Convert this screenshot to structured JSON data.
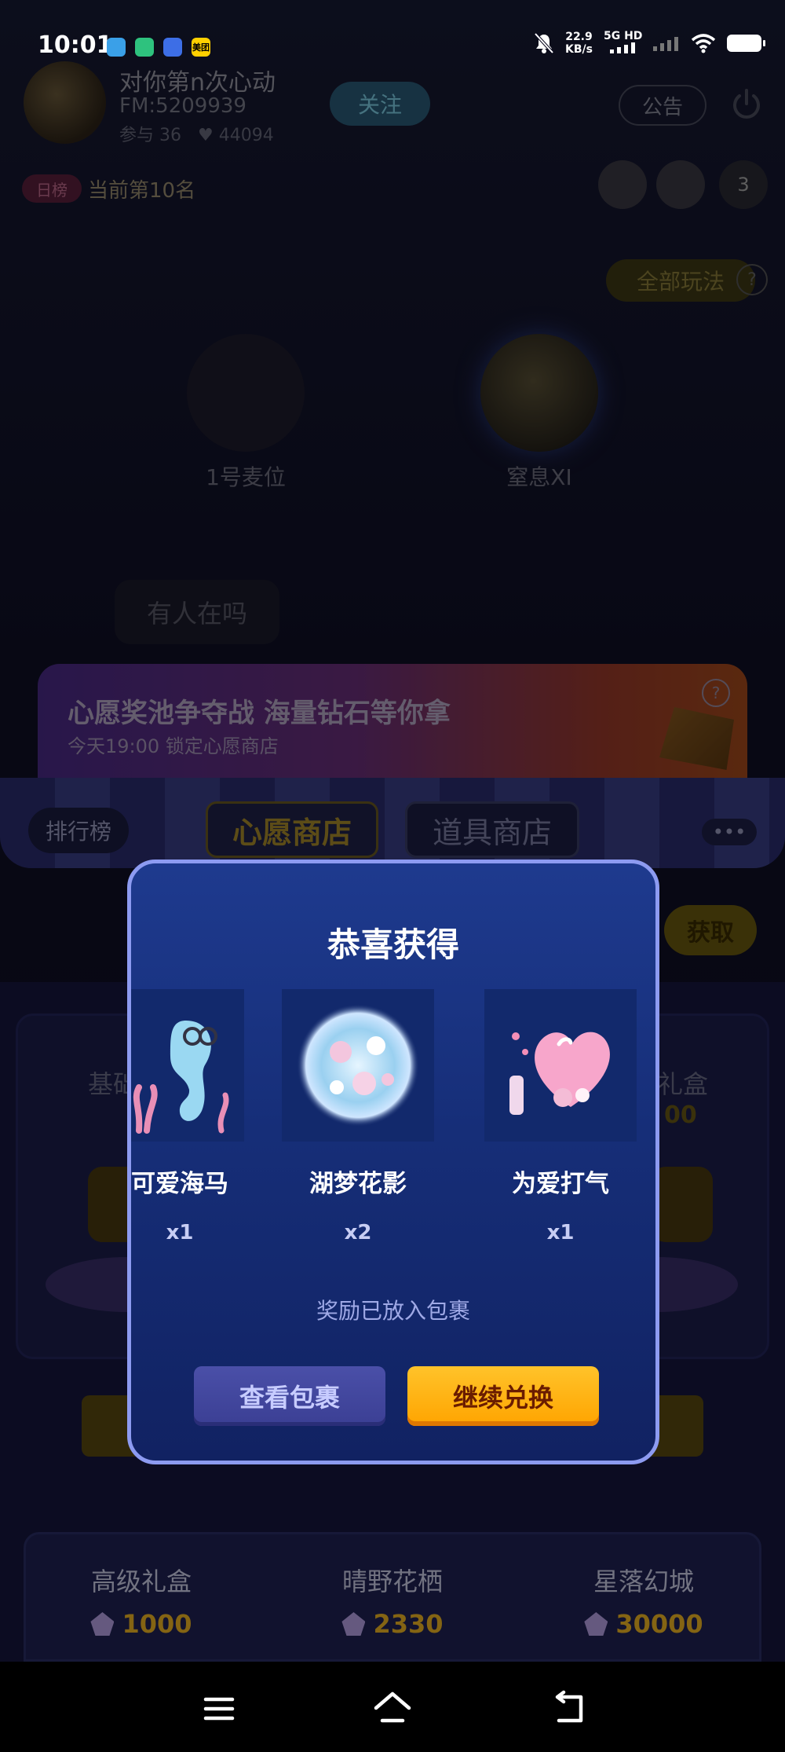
{
  "status_bar": {
    "time": "10:01",
    "speed_value": "22.9",
    "speed_unit": "KB/s",
    "network": "5G HD",
    "apps": [
      "app-icon-blue",
      "app-icon-green",
      "app-icon-baidu",
      "meituan-icon"
    ],
    "app_meituan_label": "美团"
  },
  "room": {
    "title": "对你第n次心动",
    "room_id": "FM:5209939",
    "members": "参与 36",
    "hearts": "44094",
    "follow_label": "关注",
    "notice_label": "公告",
    "rank_badge": "日榜",
    "rank_text": "当前第10名",
    "online_count": "3",
    "playall_label": "全部玩法",
    "seats": [
      {
        "label": "1号麦位"
      },
      {
        "label": "窒息XI"
      }
    ],
    "message": "有人在吗"
  },
  "banner": {
    "title": "心愿奖池争夺战 海量钻石等你拿",
    "subtitle": "今天19:00 锁定心愿商店",
    "help": "?"
  },
  "shop": {
    "rank_tab": "排行榜",
    "wish_tab": "心愿商店",
    "item_tab": "道具商店",
    "more": "•••",
    "get_button": "获取",
    "left_box_label": "基础",
    "right_box_label": "礼盒",
    "right_box_price": "00",
    "bottom_items": [
      {
        "name": "高级礼盒",
        "price": "1000"
      },
      {
        "name": "晴野花栖",
        "price": "2330"
      },
      {
        "name": "星落幻城",
        "price": "30000"
      }
    ]
  },
  "modal": {
    "title": "恭喜获得",
    "rewards": [
      {
        "name": "可爱海马",
        "qty": "x1",
        "icon": "seahorse-image"
      },
      {
        "name": "湖梦花影",
        "qty": "x2",
        "icon": "flower-orb-image"
      },
      {
        "name": "为爱打气",
        "qty": "x1",
        "icon": "heart-balloon-image"
      }
    ],
    "tip": "奖励已放入包裹",
    "view_button": "查看包裹",
    "continue_button": "继续兑换"
  },
  "colors": {
    "modal_border": "#8d9bf1",
    "modal_bg": "#1e3a8e",
    "continue_bg": "#ffb014",
    "view_bg": "#4349a2",
    "price_gold": "#f0b624"
  }
}
